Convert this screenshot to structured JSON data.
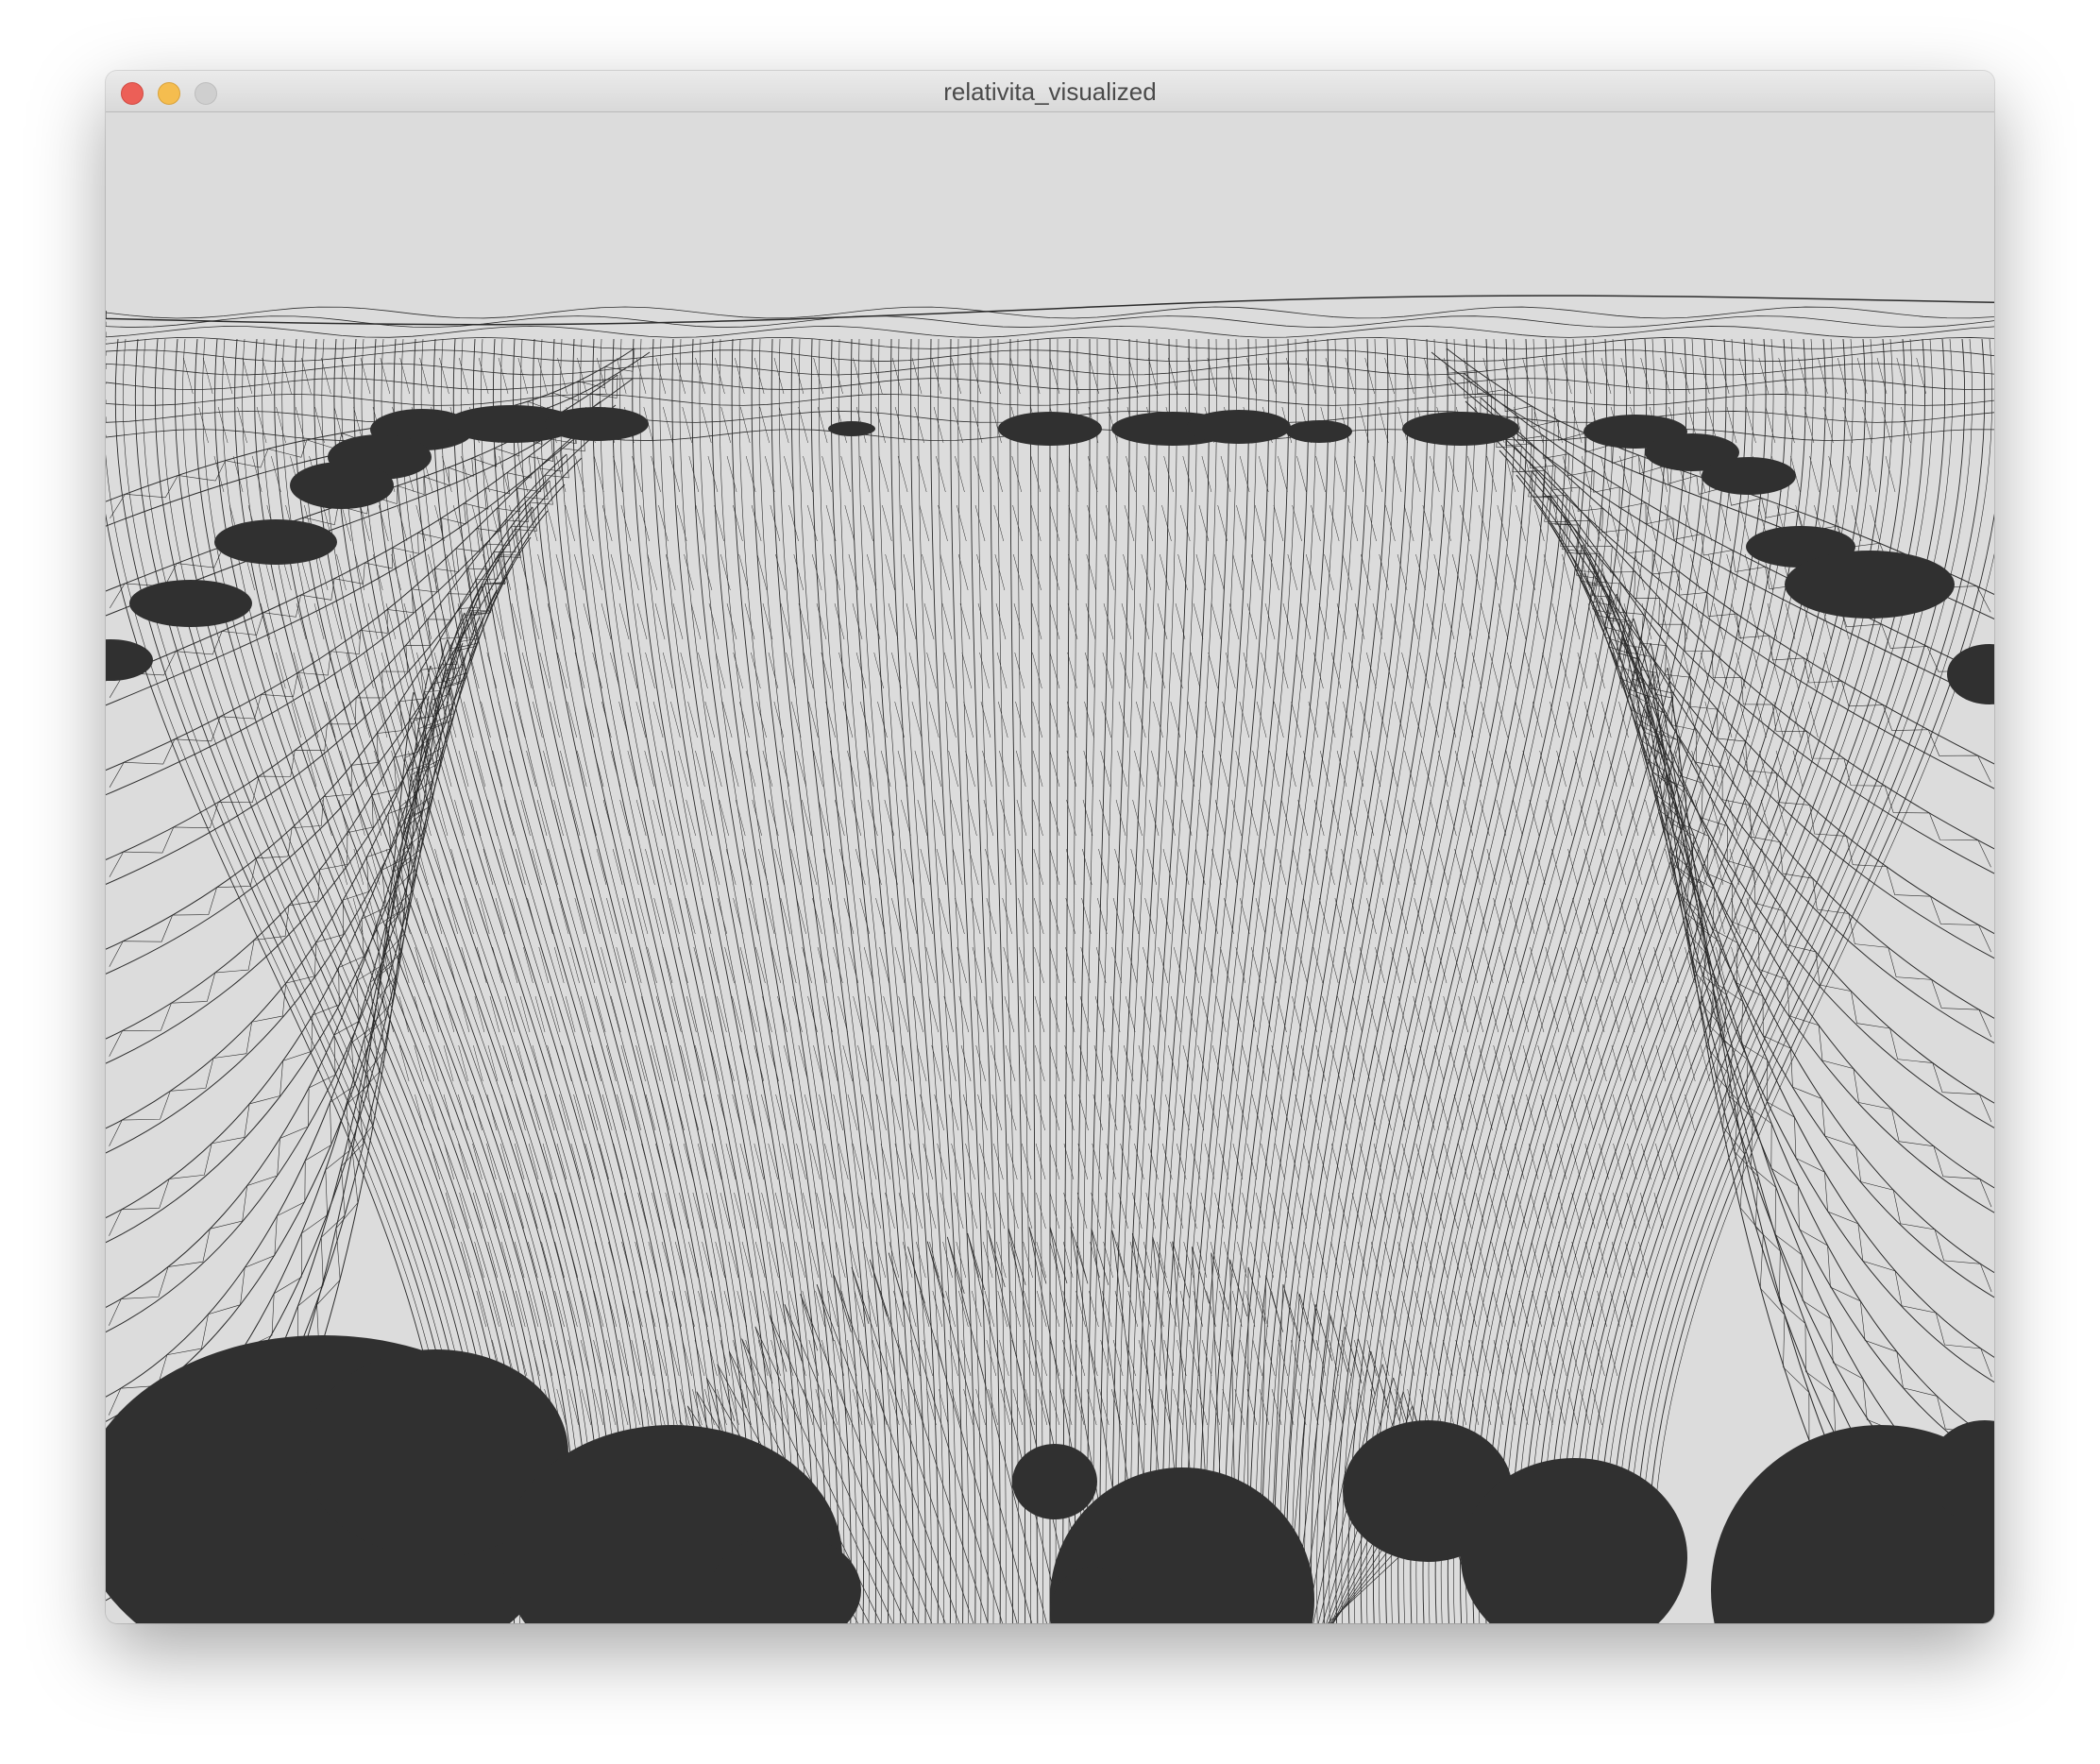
{
  "window": {
    "title": "relativita_visualized",
    "controls": {
      "close": "close",
      "minimize": "minimize",
      "maximize": "maximize"
    }
  },
  "scene": {
    "background_color": "#dcdcdc",
    "mesh_color": "#2b2b2b",
    "body_color": "#303030",
    "description": "wireframe spacetime grid"
  }
}
